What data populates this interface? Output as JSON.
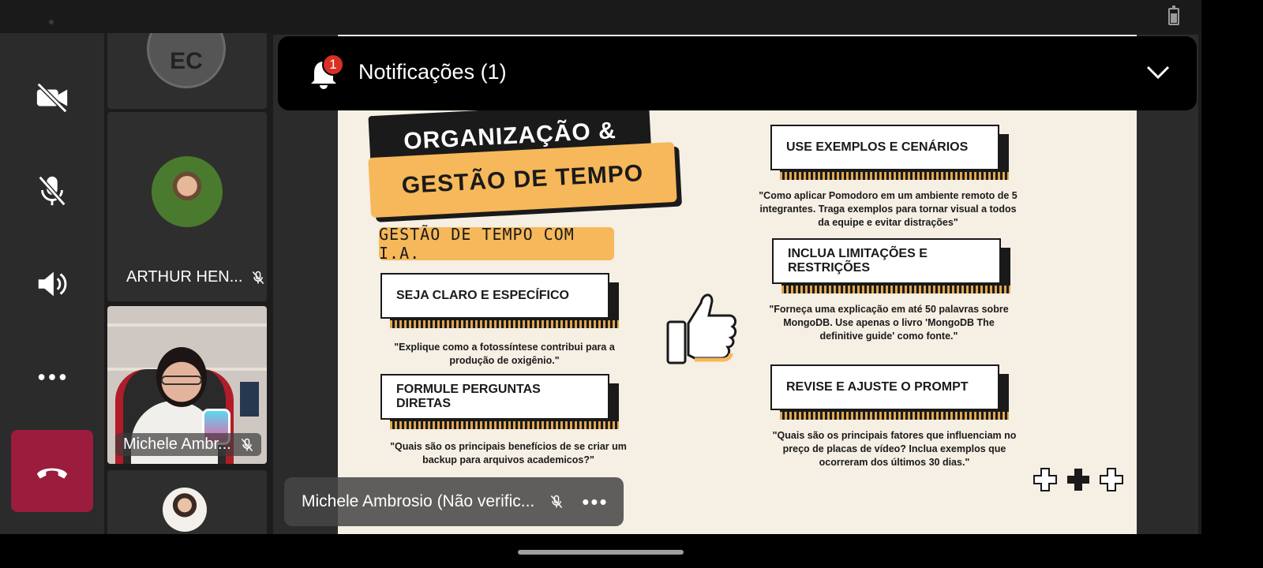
{
  "notification": {
    "title": "Notificações (1)",
    "badge": "1"
  },
  "controls": {
    "video": "video-off-icon",
    "mic": "mic-off-icon",
    "speaker": "speaker-icon",
    "more": "more-icon",
    "hangup": "hangup-icon",
    "hangup_color": "#9b1c3c"
  },
  "participants": [
    {
      "initials": "EC"
    },
    {
      "name": "ARTHUR HEN..."
    },
    {
      "name": "Michele Ambr..."
    },
    {
      "name": ""
    }
  ],
  "presenter": {
    "name": "Michele Ambrosio (Não verific...",
    "more": "•••"
  },
  "slide": {
    "title_line1": "ORGANIZAÇÃO &",
    "title_line2": "GESTÃO DE TEMPO",
    "subtitle": "GESTÃO DE TEMPO COM I.A.",
    "accent_color": "#f6b85a",
    "cards": [
      {
        "heading": "SEJA CLARO E ESPECÍFICO",
        "quote": "\"Explique como a fotossíntese contribui para a produção de oxigênio.\""
      },
      {
        "heading": "FORMULE PERGUNTAS DIRETAS",
        "quote": "\"Quais são os principais benefícios de se criar um backup para arquivos academicos?\""
      },
      {
        "heading": "USE EXEMPLOS E CENÁRIOS",
        "quote": "\"Como aplicar Pomodoro em um ambiente remoto de 5 integrantes. Traga exemplos para tornar visual a todos da equipe e evitar distrações\""
      },
      {
        "heading": "INCLUA LIMITAÇÕES E RESTRIÇÕES",
        "quote": "\"Forneça uma explicação em até 50 palavras sobre MongoDB. Use apenas o livro 'MongoDB The definitive guide' como fonte.\""
      },
      {
        "heading": "REVISE E AJUSTE O PROMPT",
        "quote": "\"Quais são os principais fatores que influenciam no preço de placas de vídeo? Inclua exemplos que ocorreram dos últimos 30 dias.\""
      }
    ]
  }
}
